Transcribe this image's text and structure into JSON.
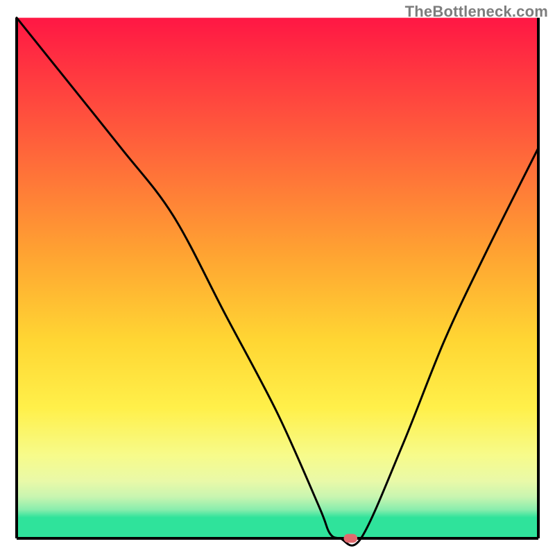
{
  "watermark": "TheBottleneck.com",
  "chart_data": {
    "type": "line",
    "title": "",
    "xlabel": "",
    "ylabel": "",
    "xlim": [
      0,
      100
    ],
    "ylim": [
      0,
      100
    ],
    "grid": false,
    "legend": false,
    "gradient_stops": [
      {
        "y_pct": 0,
        "color": "#ff1744"
      },
      {
        "y_pct": 22,
        "color": "#ff5a3c"
      },
      {
        "y_pct": 45,
        "color": "#ffa232"
      },
      {
        "y_pct": 62,
        "color": "#ffd633"
      },
      {
        "y_pct": 75,
        "color": "#fff04a"
      },
      {
        "y_pct": 84,
        "color": "#f7fb8a"
      },
      {
        "y_pct": 89,
        "color": "#e9f9a8"
      },
      {
        "y_pct": 92,
        "color": "#c9f5b0"
      },
      {
        "y_pct": 94.5,
        "color": "#88edad"
      },
      {
        "y_pct": 96,
        "color": "#2fe39b"
      },
      {
        "y_pct": 100,
        "color": "#2fe39b"
      }
    ],
    "series": [
      {
        "name": "bottleneck-curve",
        "x": [
          0,
          8,
          20,
          30,
          40,
          50,
          58,
          60,
          62,
          66,
          74,
          82,
          90,
          100
        ],
        "y": [
          100,
          90,
          75,
          62,
          43,
          24,
          6,
          1,
          0,
          0,
          18,
          38,
          55,
          75
        ]
      }
    ],
    "marker": {
      "name": "optimal-point",
      "x_pct": 64,
      "y_pct": 0,
      "color": "#e06a6e",
      "width_pct": 2.6,
      "height_pct": 1.7
    },
    "axes": {
      "left": {
        "x_pct": 3.0
      },
      "right": {
        "x_pct": 97.0
      },
      "bottom": {
        "y_pct": 97.0
      },
      "top": {
        "y_pct": 3.2
      }
    }
  }
}
